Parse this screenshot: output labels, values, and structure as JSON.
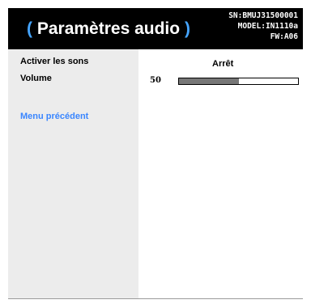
{
  "header": {
    "title_open": "(",
    "title": "Paramètres audio",
    "title_close": ")",
    "sn": "SN:BMUJ31500001",
    "model": "MODEL:IN1110a",
    "fw": "FW:A06"
  },
  "menu": {
    "items": [
      {
        "label": "Activer les sons"
      },
      {
        "label": "Volume"
      }
    ],
    "back_label": "Menu précédent"
  },
  "values": {
    "sound": "Arrêt",
    "volume_number": "50",
    "volume_level": 0.5
  },
  "colors": {
    "accent": "#45a5ff",
    "link": "#3a86ff",
    "header_bg": "#000000",
    "panel_bg": "#ececec",
    "slider_fill": "#777777"
  }
}
